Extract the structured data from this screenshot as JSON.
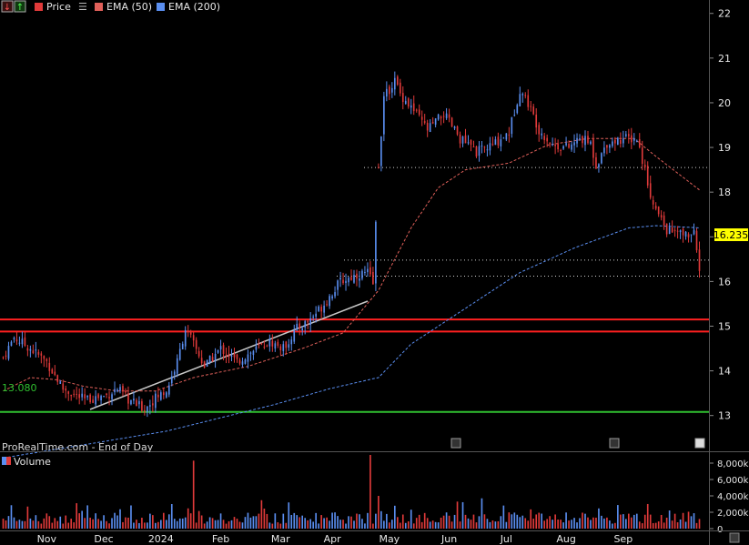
{
  "header": {
    "price_label": "Price",
    "ema50_label": "EMA (50)",
    "ema200_label": "EMA (200)",
    "ema50_color": "#e0605a",
    "ema200_color": "#5a8ef0",
    "volume_label": "Volume"
  },
  "watermark": "ProRealTime.com - End of Day",
  "last_price_label": "16.235",
  "support_label": "13.080",
  "colors": {
    "up": "#5a8ef0",
    "down": "#e03a3a",
    "resistance": "#ff2020",
    "support": "#30c030",
    "trendline": "#c8c8c8",
    "dotted": "#d0d0d0",
    "last_price_bg": "#ffff00"
  },
  "chart_data": {
    "type": "candlestick",
    "price_axis": {
      "ticks": [
        "22",
        "21",
        "20",
        "19",
        "18",
        "17",
        "16",
        "15",
        "14",
        "13"
      ],
      "range": [
        12.2,
        22.3
      ]
    },
    "volume_axis": {
      "ticks": [
        "8,000k",
        "6,000k",
        "4,000k",
        "2,000k",
        "0"
      ],
      "range": [
        0,
        9000
      ]
    },
    "x_labels": [
      "Nov",
      "Dec",
      "2024",
      "Feb",
      "Mar",
      "Apr",
      "May",
      "Jun",
      "Jul",
      "Aug",
      "Sep"
    ],
    "horizontal_lines": {
      "resistance": [
        15.15,
        14.88
      ],
      "support": 13.08,
      "dotted": [
        18.55,
        16.48,
        16.12
      ]
    },
    "last_price": 16.235,
    "price_keypoints": [
      [
        0,
        14.3
      ],
      [
        4,
        14.75
      ],
      [
        10,
        14.5
      ],
      [
        16,
        14.2
      ],
      [
        22,
        13.6
      ],
      [
        30,
        13.35
      ],
      [
        38,
        13.45
      ],
      [
        42,
        13.6
      ],
      [
        46,
        13.35
      ],
      [
        52,
        13.15
      ],
      [
        56,
        13.4
      ],
      [
        60,
        13.55
      ],
      [
        64,
        14.2
      ],
      [
        67,
        14.95
      ],
      [
        70,
        14.6
      ],
      [
        74,
        14.1
      ],
      [
        80,
        14.5
      ],
      [
        86,
        14.2
      ],
      [
        92,
        14.45
      ],
      [
        98,
        14.65
      ],
      [
        103,
        14.5
      ],
      [
        108,
        14.95
      ],
      [
        112,
        15.1
      ],
      [
        118,
        15.5
      ],
      [
        124,
        16.0
      ],
      [
        130,
        16.15
      ],
      [
        134,
        16.2
      ],
      [
        136,
        15.95
      ],
      [
        138,
        18.6
      ],
      [
        140,
        20.1
      ],
      [
        144,
        20.5
      ],
      [
        146,
        20.2
      ],
      [
        150,
        19.9
      ],
      [
        156,
        19.4
      ],
      [
        162,
        19.75
      ],
      [
        168,
        19.2
      ],
      [
        174,
        18.9
      ],
      [
        180,
        19.05
      ],
      [
        186,
        19.35
      ],
      [
        190,
        20.3
      ],
      [
        193,
        20.0
      ],
      [
        197,
        19.4
      ],
      [
        202,
        19.05
      ],
      [
        208,
        19.0
      ],
      [
        212,
        19.2
      ],
      [
        216,
        19.1
      ],
      [
        218,
        18.6
      ],
      [
        222,
        19.1
      ],
      [
        228,
        19.2
      ],
      [
        233,
        19.2
      ],
      [
        236,
        18.5
      ],
      [
        239,
        17.7
      ],
      [
        244,
        17.15
      ],
      [
        250,
        17.05
      ],
      [
        254,
        17.05
      ],
      [
        256,
        16.235
      ]
    ],
    "ema50_keypoints": [
      [
        0,
        13.55
      ],
      [
        10,
        13.85
      ],
      [
        20,
        13.8
      ],
      [
        30,
        13.65
      ],
      [
        42,
        13.55
      ],
      [
        56,
        13.55
      ],
      [
        70,
        13.85
      ],
      [
        90,
        14.1
      ],
      [
        110,
        14.5
      ],
      [
        125,
        14.85
      ],
      [
        138,
        15.8
      ],
      [
        150,
        17.2
      ],
      [
        160,
        18.1
      ],
      [
        170,
        18.5
      ],
      [
        186,
        18.65
      ],
      [
        200,
        19.05
      ],
      [
        215,
        19.2
      ],
      [
        232,
        19.2
      ],
      [
        240,
        18.8
      ],
      [
        256,
        18.05
      ]
    ],
    "ema200_keypoints": [
      [
        0,
        12.05
      ],
      [
        20,
        12.25
      ],
      [
        40,
        12.45
      ],
      [
        60,
        12.65
      ],
      [
        80,
        12.95
      ],
      [
        100,
        13.25
      ],
      [
        120,
        13.6
      ],
      [
        138,
        13.85
      ],
      [
        150,
        14.6
      ],
      [
        170,
        15.4
      ],
      [
        190,
        16.2
      ],
      [
        210,
        16.75
      ],
      [
        230,
        17.2
      ],
      [
        240,
        17.25
      ],
      [
        256,
        17.2
      ]
    ]
  }
}
